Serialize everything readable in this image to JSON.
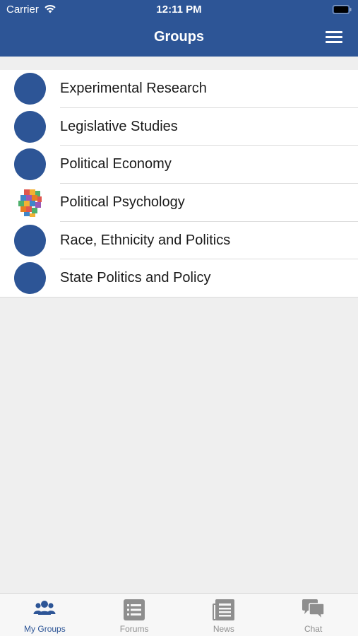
{
  "status_bar": {
    "carrier": "Carrier",
    "time": "12:11 PM"
  },
  "header": {
    "title": "Groups"
  },
  "groups": [
    {
      "label": "Experimental Research",
      "avatar": "blue-circle"
    },
    {
      "label": "Legislative Studies",
      "avatar": "blue-circle"
    },
    {
      "label": "Political Economy",
      "avatar": "blue-circle"
    },
    {
      "label": "Political Psychology",
      "avatar": "puzzle-head-image"
    },
    {
      "label": "Race, Ethnicity and Politics",
      "avatar": "blue-circle"
    },
    {
      "label": "State Politics and Policy",
      "avatar": "blue-circle"
    }
  ],
  "tabs": [
    {
      "label": "My Groups",
      "icon": "people-icon",
      "active": true
    },
    {
      "label": "Forums",
      "icon": "list-icon",
      "active": false
    },
    {
      "label": "News",
      "icon": "newspaper-icon",
      "active": false
    },
    {
      "label": "Chat",
      "icon": "chat-bubbles-icon",
      "active": false
    }
  ],
  "colors": {
    "brand": "#2d5596",
    "tab_inactive": "#8e8e8e",
    "background": "#efefef"
  }
}
